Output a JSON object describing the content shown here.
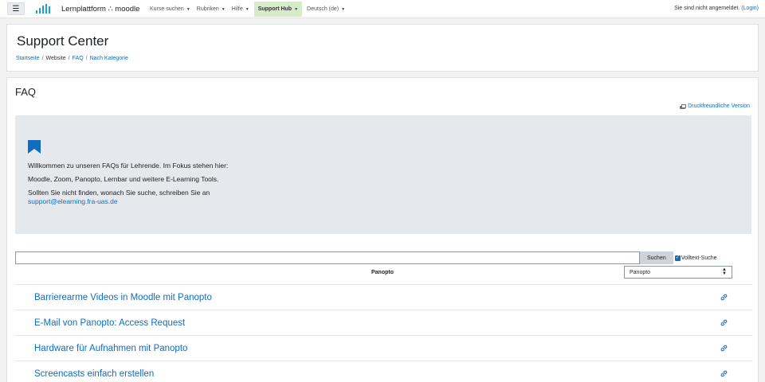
{
  "navbar": {
    "menu_icon": "hamburger-icon",
    "brand": "Lernplattform ∴ moodle",
    "items": [
      {
        "label": "Kurse suchen",
        "active": false
      },
      {
        "label": "Rubriken",
        "active": false
      },
      {
        "label": "Hilfe",
        "active": false
      },
      {
        "label": "Support Hub",
        "active": true
      },
      {
        "label": "Deutsch (de)",
        "active": false
      }
    ],
    "login_text": "Sie sind nicht angemeldet.",
    "login_link": "(Login)"
  },
  "header": {
    "title": "Support Center",
    "breadcrumb": [
      "Startseite",
      "Website",
      "FAQ",
      "Nach Kategorie"
    ]
  },
  "main": {
    "title": "FAQ",
    "print_link": "Druckfreundliche Version",
    "intro": {
      "icon": "bookmark-icon",
      "line1": "Willkommen zu unseren FAQs für Lehrende. Im Fokus stehen hier:",
      "line2": "Moodle, Zoom, Panopto, Lernbar und weitere E-Learning Tools.",
      "line3": "Sollten Sie nicht finden, wonach Sie suche, schreiben Sie an",
      "email": "support@elearning.fra-uas.de"
    },
    "search": {
      "value": "",
      "placeholder": "",
      "button": "Suchen",
      "fulltext_label": "Volltext-Suche",
      "fulltext_checked": true
    },
    "category": {
      "label": "Panopto",
      "selected": "Panopto"
    },
    "faq_items": [
      "Barrierearme Videos in Moodle mit Panopto",
      "E-Mail von Panopto: Access Request",
      "Hardware für Aufnahmen mit Panopto",
      "Screencasts einfach erstellen"
    ]
  },
  "colors": {
    "accent": "#0f6cbf",
    "active_nav": "#d7eacb",
    "intro_bg": "#e5e9ee",
    "logo": "#1aa0d6"
  }
}
